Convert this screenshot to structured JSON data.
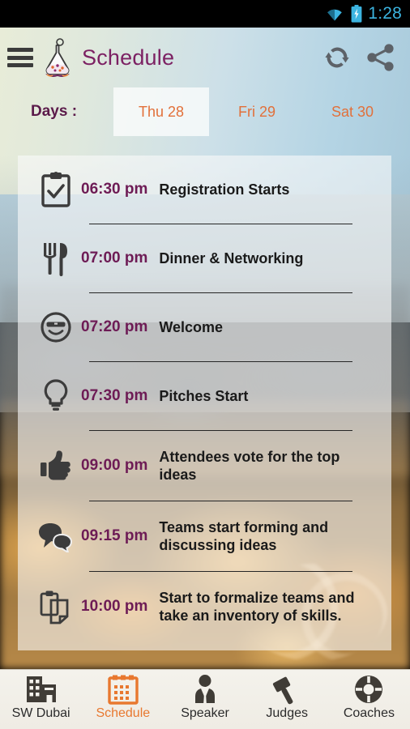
{
  "status_bar": {
    "clock": "1:28",
    "wifi_icon": "wifi-icon",
    "battery_icon": "battery-charging-icon",
    "accent_color": "#3cb4e0"
  },
  "action_bar": {
    "menu_icon": "hamburger-menu-icon",
    "logo_icon": "flask-logo-icon",
    "title": "Schedule",
    "title_color": "#7c2163",
    "refresh_icon": "refresh-icon",
    "share_icon": "share-icon"
  },
  "days": {
    "label": "Days :",
    "label_color": "#5b1a4a",
    "tab_color": "#e2703a",
    "tabs": [
      {
        "label": "Thu 28",
        "active": true
      },
      {
        "label": "Fri 29",
        "active": false
      },
      {
        "label": "Sat 30",
        "active": false
      }
    ]
  },
  "schedule": {
    "time_color": "#6d1b55",
    "title_color": "#1a1a1a",
    "items": [
      {
        "icon": "clipboard-check-icon",
        "time": "06:30 pm",
        "title": "Registration Starts"
      },
      {
        "icon": "fork-knife-icon",
        "time": "07:00 pm",
        "title": "Dinner & Networking"
      },
      {
        "icon": "smiley-sunglasses-icon",
        "time": "07:20 pm",
        "title": "Welcome"
      },
      {
        "icon": "lightbulb-icon",
        "time": "07:30 pm",
        "title": "Pitches Start"
      },
      {
        "icon": "thumbs-up-icon",
        "time": "09:00 pm",
        "title": "Attendees vote for the top ideas"
      },
      {
        "icon": "speech-bubbles-icon",
        "time": "09:15 pm",
        "title": "Teams start forming and discussing ideas"
      },
      {
        "icon": "clipboard-copy-icon",
        "time": "10:00 pm",
        "title": "Start to formalize teams and take an inventory of skills."
      }
    ]
  },
  "bottom_nav": {
    "active_color": "#e8782f",
    "items": [
      {
        "icon": "buildings-icon",
        "label": "SW Dubai",
        "active": false
      },
      {
        "icon": "calendar-icon",
        "label": "Schedule",
        "active": true
      },
      {
        "icon": "speaker-person-icon",
        "label": "Speaker",
        "active": false
      },
      {
        "icon": "gavel-icon",
        "label": "Judges",
        "active": false
      },
      {
        "icon": "lifebuoy-icon",
        "label": "Coaches",
        "active": false
      }
    ]
  }
}
